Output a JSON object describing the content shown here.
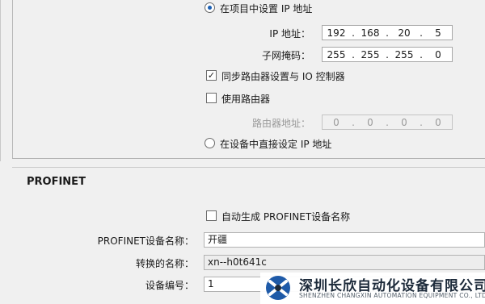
{
  "ip_section": {
    "radio_set_in_project": "在项目中设置 IP 地址",
    "ip_label": "IP 地址：",
    "ip_octets": [
      "192",
      "168",
      "20",
      "5"
    ],
    "mask_label": "子网掩码：",
    "mask_octets": [
      "255",
      "255",
      "255",
      "0"
    ],
    "sync_router_label": "同步路由器设置与 IO 控制器",
    "use_router_label": "使用路由器",
    "router_addr_label": "路由器地址：",
    "router_octets": [
      "0",
      "0",
      "0",
      "0"
    ],
    "radio_set_on_device": "在设备中直接设定 IP 地址"
  },
  "profinet": {
    "title": "PROFINET",
    "auto_generate_label": "自动生成 PROFINET设备名称",
    "device_name_label": "PROFINET设备名称：",
    "device_name_value": "开疆",
    "converted_name_label": "转换的名称：",
    "converted_name_value": "xn--h0t641c",
    "device_number_label": "设备编号：",
    "device_number_value": "1"
  },
  "watermark": {
    "company_cn": "深圳长欣自动化设备有限公司",
    "company_en": "SHENZHEN CHANGXIN AUTOMATION EQUIPMENT CO., LTD",
    "colors": {
      "blue": "#1e5aa8",
      "navy": "#1c2a3a"
    }
  }
}
